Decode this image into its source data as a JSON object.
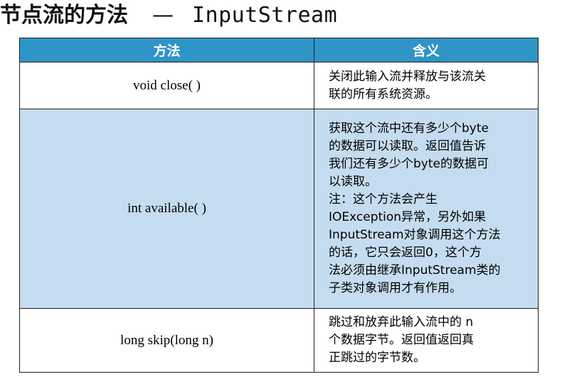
{
  "title": {
    "chinese": "节点流的方法",
    "dash": "—",
    "class_name": "InputStream"
  },
  "table": {
    "headers": [
      "方法",
      "含义"
    ],
    "rows": [
      {
        "method": "void close( )",
        "description_lines": [
          "关闭此输入流并释放与该流关",
          "联的所有系统资源。"
        ]
      },
      {
        "method": "int available( )",
        "description_lines": [
          "获取这个流中还有多少个byte",
          "的数据可以读取。返回值告诉",
          "我们还有多少个byte的数据可",
          "以读取。",
          "注：这个方法会产生",
          "IOException异常，另外如果",
          "InputStream对象调用这个方法",
          "的话，它只会返回0，这个方",
          "法必须由继承InputStream类的",
          "子类对象调用才有作用。"
        ]
      },
      {
        "method": "long skip(long n)",
        "description_lines": [
          "跳过和放弃此输入流中的 n",
          "个数据字节。返回值返回真",
          "正跳过的字节数。"
        ]
      }
    ]
  },
  "colors": {
    "header_bg": "#2f94c6",
    "header_text": "#ffffff",
    "shaded_row_bg": "#c5dcf0",
    "border": "#222222"
  }
}
